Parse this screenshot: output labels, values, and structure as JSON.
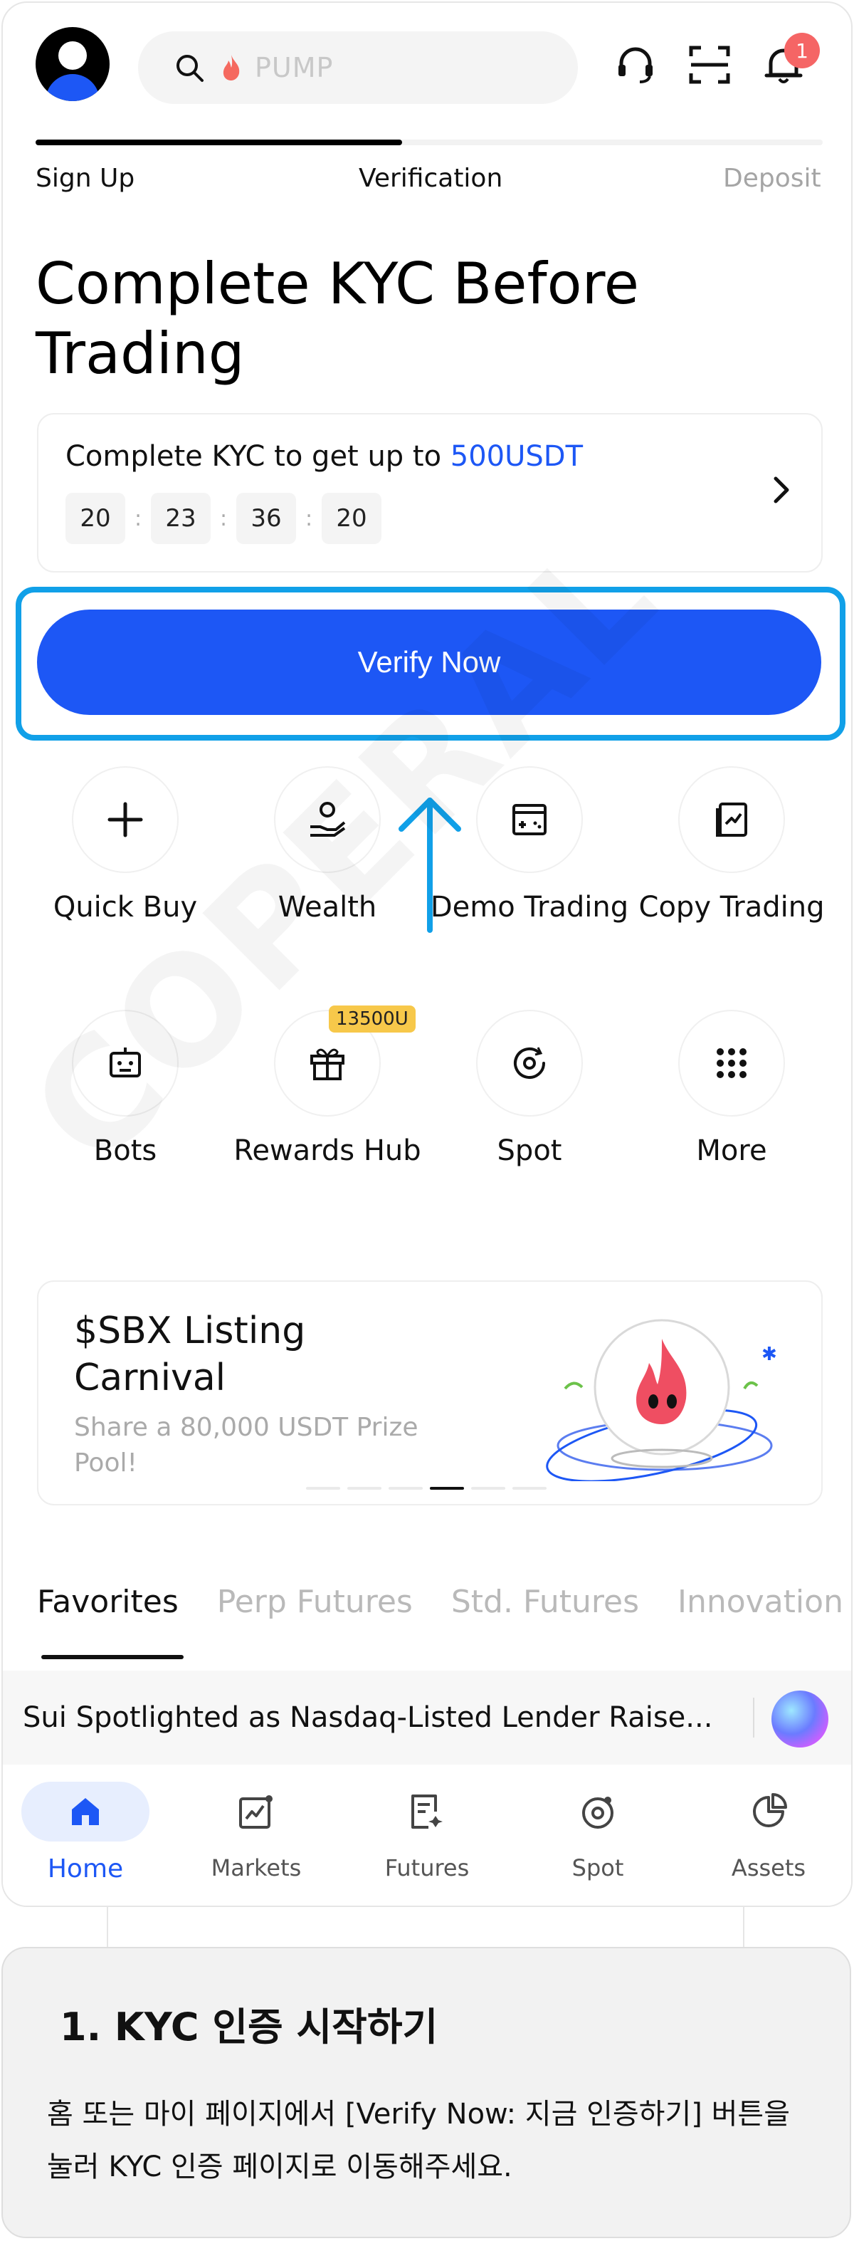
{
  "header": {
    "search_placeholder": "PUMP",
    "notification_count": "1",
    "icons": [
      "avatar",
      "search-icon",
      "flame-icon",
      "headset-icon",
      "scan-icon",
      "bell-icon"
    ]
  },
  "progress": {
    "fraction": 0.466,
    "steps": [
      "Sign Up",
      "Verification",
      "Deposit"
    ]
  },
  "title": "Complete KYC Before Trading",
  "kyc_card": {
    "text": "Complete KYC to get up to ",
    "amount": "500USDT",
    "timer": [
      "20",
      "23",
      "36",
      "20"
    ],
    "separator": ":"
  },
  "verify_button": "Verify Now",
  "quick_actions": [
    {
      "label": "Quick Buy",
      "icon": "plus-icon"
    },
    {
      "label": "Wealth",
      "icon": "hand-coin-icon"
    },
    {
      "label": "Demo Trading",
      "icon": "demo-trading-icon"
    },
    {
      "label": "Copy Trading",
      "icon": "copy-trading-icon"
    },
    {
      "label": "Bots",
      "icon": "bot-icon"
    },
    {
      "label": "Rewards Hub",
      "icon": "gift-icon",
      "tag": "13500U"
    },
    {
      "label": "Spot",
      "icon": "spot-icon"
    },
    {
      "label": "More",
      "icon": "grid-dots-icon"
    }
  ],
  "banner": {
    "title": "$SBX Listing Carnival",
    "subtitle": "Share a 80,000 USDT Prize Pool!",
    "active_dot": 3,
    "dot_count": 6
  },
  "tabs": [
    "Favorites",
    "Perp Futures",
    "Std. Futures",
    "Innovation"
  ],
  "news": "Sui Spotlighted as Nasdaq-Listed Lender Raise...",
  "bottom_nav": [
    {
      "label": "Home",
      "icon": "home-icon",
      "active": true
    },
    {
      "label": "Markets",
      "icon": "markets-icon"
    },
    {
      "label": "Futures",
      "icon": "futures-icon"
    },
    {
      "label": "Spot",
      "icon": "spot-nav-icon"
    },
    {
      "label": "Assets",
      "icon": "assets-icon"
    }
  ],
  "watermark": "COPERAL",
  "instruction": {
    "heading": "1. KYC 인증 시작하기",
    "body": "홈 또는 마이 페이지에서 [Verify Now: 지금 인증하기] 버튼을 눌러 KYC 인증 페이지로 이동해주세요."
  },
  "colors": {
    "brand": "#1d57f5",
    "highlight": "#11a0e8",
    "badge": "#f56565",
    "tag": "#f7c84a"
  }
}
